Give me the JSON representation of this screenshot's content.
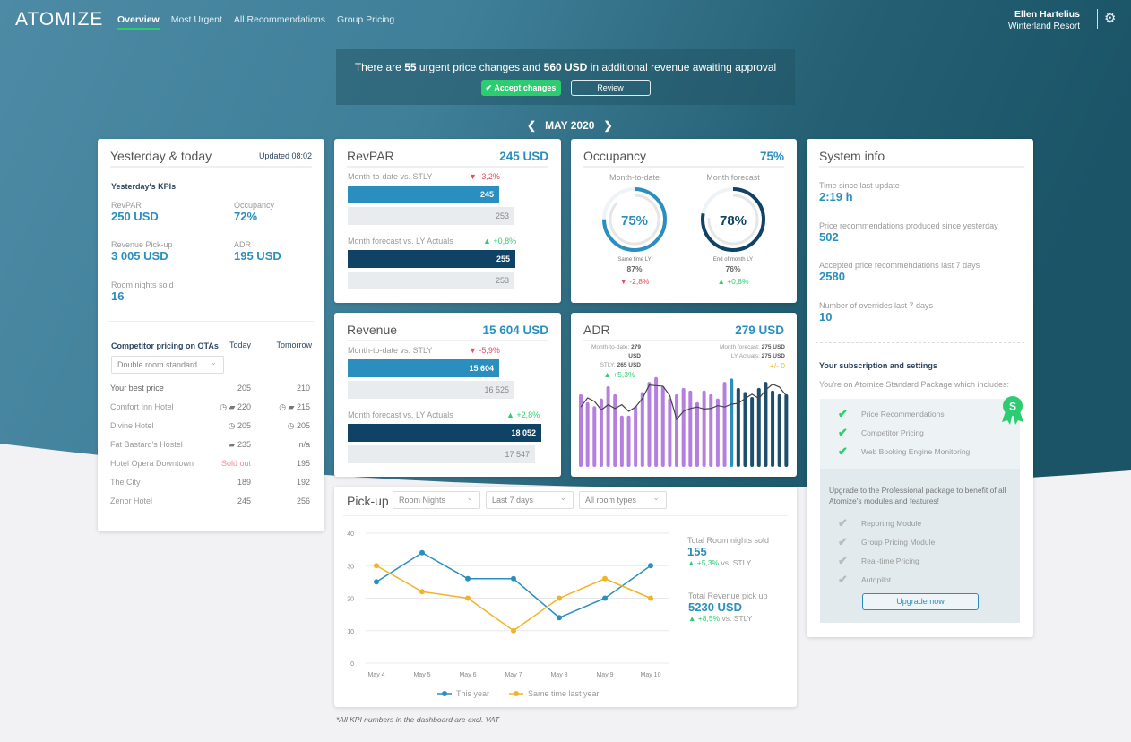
{
  "nav": {
    "logo": "ATOMIZE",
    "items": [
      "Overview",
      "Most Urgent",
      "All Recommendations",
      "Group Pricing"
    ],
    "user_name": "Ellen Hartelius",
    "hotel": "Winterland Resort"
  },
  "banner": {
    "pre": "There are ",
    "count": "55",
    "mid": " urgent price changes and ",
    "amount": "560 USD",
    "post": " in additional revenue awaiting approval",
    "accept": "Accept changes",
    "review": "Review"
  },
  "month": "MAY 2020",
  "yesterday": {
    "title": "Yesterday & today",
    "updated": "Updated 08:02",
    "kpi_title": "Yesterday's KPIs",
    "kpis": [
      {
        "label": "RevPAR",
        "value": "250 USD"
      },
      {
        "label": "Occupancy",
        "value": "72%"
      },
      {
        "label": "Revenue Pick-up",
        "value": "3 005 USD"
      },
      {
        "label": "ADR",
        "value": "195 USD"
      },
      {
        "label": "Room nights sold",
        "value": "16"
      }
    ],
    "comp_title": "Competitor pricing on OTAs",
    "today": "Today",
    "tomorrow": "Tomorrow",
    "room_select": "Double room standard",
    "rows": [
      {
        "name": "Your best price",
        "today": "205",
        "tomorrow": "210"
      },
      {
        "name": "Comfort Inn Hotel",
        "today": "◷ ▰ 220",
        "tomorrow": "◷ ▰ 215"
      },
      {
        "name": "Divine Hotel",
        "today": "◷ 205",
        "tomorrow": "◷ 205"
      },
      {
        "name": "Fat Bastard's Hostel",
        "today": "▰ 235",
        "tomorrow": "n/a"
      },
      {
        "name": "Hotel Opera Downtown",
        "today": "Sold out",
        "tomorrow": "195"
      },
      {
        "name": "The City",
        "today": "189",
        "tomorrow": "192"
      },
      {
        "name": "Zenor Hotel",
        "today": "245",
        "tomorrow": "256"
      }
    ]
  },
  "revpar": {
    "title": "RevPAR",
    "value": "245 USD",
    "mtd_label": "Month-to-date vs. STLY",
    "mtd_change": "▼ -3,2%",
    "mtd": "245",
    "stly": "253",
    "fc_label": "Month forecast vs. LY Actuals",
    "fc_change": "▲ +0,8%",
    "fc": "255",
    "ly": "253"
  },
  "revenue": {
    "title": "Revenue",
    "value": "15 604 USD",
    "mtd_label": "Month-to-date vs. STLY",
    "mtd_change": "▼ -5,9%",
    "mtd": "15 604",
    "stly": "16 525",
    "fc_label": "Month forecast vs. LY Actuals",
    "fc_change": "▲ +2,8%",
    "fc": "18 052",
    "ly": "17 547"
  },
  "occupancy": {
    "title": "Occupancy",
    "value": "75%",
    "mtd_label": "Month-to-date",
    "mtd": "75%",
    "mtd_pct": 75,
    "mtd_ref_pct": 87,
    "mtd_ref_label": "Same time LY",
    "mtd_ref": "87%",
    "mtd_change": "▼ -2,8%",
    "fc_label": "Month forecast",
    "fc": "78%",
    "fc_pct": 78,
    "fc_ref_pct": 76,
    "fc_ref_label": "End of month LY",
    "fc_ref": "76%",
    "fc_change": "▲ +0,8%"
  },
  "adr": {
    "title": "ADR",
    "value": "279 USD",
    "mtd_label": "Month-to-date:",
    "mtd": "279 USD",
    "stly_label": "STLY:",
    "stly": "265 USD",
    "mtd_change": "▲ +5,3%",
    "fc_label": "Month forecast:",
    "fc": "275 USD",
    "ly_label": "LY Actuals:",
    "ly": "275 USD",
    "fc_change": "+/- 0"
  },
  "chart_data": [
    {
      "type": "bar",
      "title": "ADR",
      "categories": [
        "1",
        "2",
        "3",
        "4",
        "5",
        "6",
        "7",
        "8",
        "9",
        "10",
        "11",
        "12",
        "13",
        "14",
        "15",
        "16",
        "17",
        "18",
        "19",
        "20",
        "21",
        "22",
        "23",
        "24",
        "25",
        "26",
        "27",
        "28",
        "29",
        "30",
        "31"
      ],
      "series": [
        {
          "values": [
            255,
            227,
            213,
            240,
            283,
            255,
            180,
            180,
            213,
            263,
            298,
            315,
            283,
            240,
            255,
            277,
            268,
            227,
            268,
            255,
            240,
            298,
            310,
            277,
            263,
            245,
            277,
            298,
            268,
            255,
            255
          ]
        },
        {
          "type": "line",
          "values": [
            210,
            242,
            230,
            200,
            218,
            205,
            218,
            195,
            210,
            240,
            287,
            285,
            283,
            250,
            167,
            195,
            205,
            210,
            203,
            205,
            215,
            210,
            220,
            223,
            240,
            255,
            240,
            270,
            290,
            280,
            250
          ]
        }
      ],
      "segments": {
        "actual": 22,
        "today": 1,
        "forecast": 8
      },
      "colors": {
        "actual": "#b57fe0",
        "today": "#2a8fbf",
        "forecast": "#1d4e6b",
        "line": "#444444"
      }
    },
    {
      "type": "line",
      "title": "Pick-up",
      "categories": [
        "May 4",
        "May 5",
        "May 6",
        "May 7",
        "May 8",
        "May 9",
        "May 10"
      ],
      "ylim": [
        0,
        40
      ],
      "yticks": [
        0,
        10,
        20,
        30,
        40
      ],
      "grid": true,
      "legend": "bottom",
      "series": [
        {
          "name": "This year",
          "color": "#2a8fbf",
          "values": [
            25,
            34,
            26,
            26,
            14,
            20,
            30
          ]
        },
        {
          "name": "Same time last year",
          "color": "#f0b429",
          "values": [
            30,
            22,
            20,
            10,
            20,
            26,
            20
          ]
        }
      ]
    }
  ],
  "pickup": {
    "title": "Pick-up",
    "metric": "Room Nights",
    "period": "Last 7 days",
    "room": "All room types",
    "rn_label": "Total Room nights sold",
    "rn": "155",
    "rn_change": "▲ +5,3%",
    "rn_vs": "vs. STLY",
    "rev_label": "Total Revenue pick up",
    "rev": "5230 USD",
    "rev_change": "▲ +8,5%",
    "rev_vs": "vs. STLY"
  },
  "system": {
    "title": "System info",
    "items": [
      {
        "label": "Time since last update",
        "value": "2:19 h"
      },
      {
        "label": "Price recommendations produced since yesterday",
        "value": "502"
      },
      {
        "label": "Accepted price recommendations last 7 days",
        "value": "2580"
      },
      {
        "label": "Number of overrides last 7 days",
        "value": "10"
      }
    ],
    "sub_title": "Your subscription and settings",
    "sub_text": "You're on Atomize Standard Package which includes:",
    "badge": "S",
    "included": [
      "Price Recommendations",
      "Competitor Pricing",
      "Web Booking Engine Monitoring"
    ],
    "upgrade_text": "Upgrade to the Professional package to benefit of all Atomize's modules and features!",
    "not_included": [
      "Reporting Module",
      "Group Pricing Module",
      "Real-time Pricing",
      "Autopilot"
    ],
    "upgrade_btn": "Upgrade now"
  },
  "footnote": "*All KPI numbers in the dashboard are excl. VAT"
}
